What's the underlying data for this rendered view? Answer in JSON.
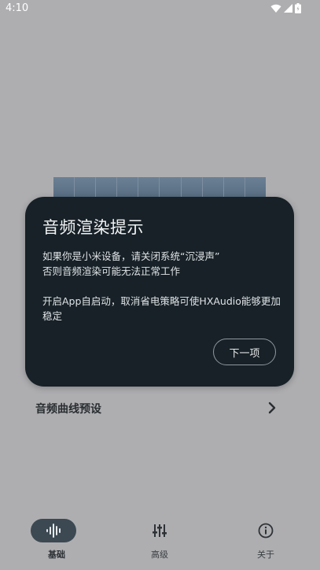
{
  "status_bar": {
    "time": "4:10"
  },
  "dialog": {
    "title": "音频渲染提示",
    "paragraph1": "如果你是小米设备，请关闭系统“沉浸声”\n否则音频渲染可能无法正常工作",
    "paragraph2": "开启App自启动，取消省电策略可使HXAudio能够更加稳定",
    "next_label": "下一项"
  },
  "preset_row": {
    "label": "音频曲线预设"
  },
  "bottom_nav": {
    "items": [
      {
        "label": "基础",
        "icon": "waveform-icon",
        "active": true
      },
      {
        "label": "高级",
        "icon": "sliders-icon",
        "active": false
      },
      {
        "label": "关于",
        "icon": "info-icon",
        "active": false
      }
    ]
  },
  "colors": {
    "scrim": "#aeaeb1",
    "dialog_bg": "#172127",
    "nav_active_pill": "#3c4952"
  }
}
